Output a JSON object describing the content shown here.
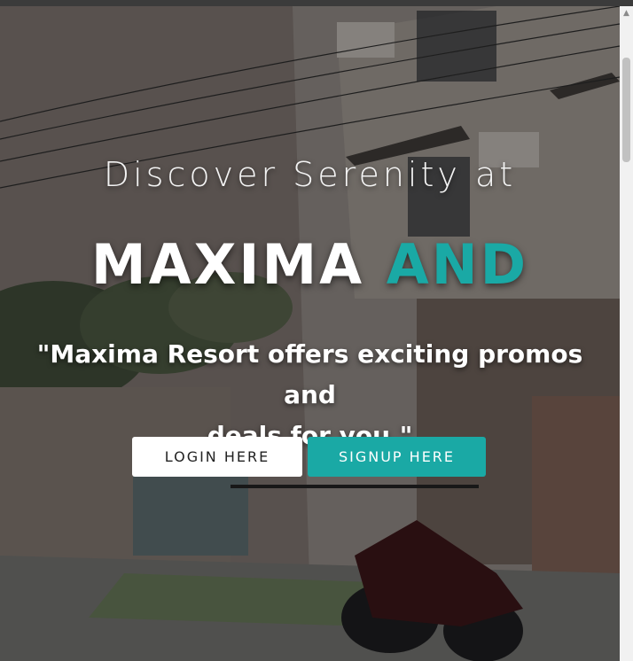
{
  "hero": {
    "eyebrow": "Discover Serenity at",
    "title_main": "MAXIMA",
    "title_accent": "AND",
    "tagline_line1": "\"Maxima Resort offers exciting promos and",
    "tagline_line2": "deals for you.\""
  },
  "actions": {
    "login_label": "LOGIN HERE",
    "signup_label": "SIGNUP HERE"
  },
  "colors": {
    "accent": "#1aa9a5",
    "login_bg": "#ffffff",
    "overlay": "rgba(0,0,0,0.28)"
  },
  "icons": {
    "scroll_up": "scroll-up-arrow-icon"
  }
}
